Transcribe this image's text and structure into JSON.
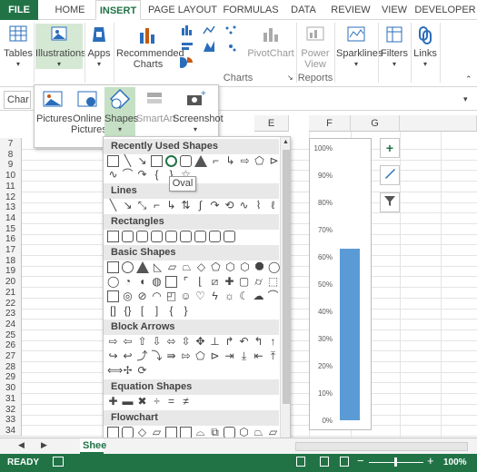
{
  "tabs": [
    "FILE",
    "HOME",
    "INSERT",
    "PAGE LAYOUT",
    "FORMULAS",
    "DATA",
    "REVIEW",
    "VIEW",
    "DEVELOPER"
  ],
  "ribbon": {
    "tables": "Tables",
    "illustrations": "Illustrations",
    "apps": "Apps",
    "recommended_charts": [
      "Recommended",
      "Charts"
    ],
    "pivotchart": "PivotChart",
    "power_view": [
      "Power",
      "View"
    ],
    "sparklines": "Sparklines",
    "filters": "Filters",
    "links": "Links",
    "group_charts": "Charts",
    "group_reports": "Reports"
  },
  "namebox": "Char",
  "illustrations_popup": {
    "pictures": "Pictures",
    "online_pictures": [
      "Online",
      "Pictures"
    ],
    "shapes": "Shapes",
    "smartart": "SmartArt",
    "screenshot": "Screenshot"
  },
  "columns": [
    "F",
    "G",
    "E"
  ],
  "rows": [
    "7",
    "8",
    "9",
    "10",
    "11",
    "12",
    "13",
    "14",
    "15",
    "16",
    "17",
    "18",
    "19",
    "20",
    "21",
    "22",
    "23",
    "24",
    "25",
    "26",
    "27",
    "28",
    "29",
    "30",
    "31",
    "32",
    "33",
    "34"
  ],
  "shapes_menu": {
    "sections": [
      "Recently Used Shapes",
      "Lines",
      "Rectangles",
      "Basic Shapes",
      "Block Arrows",
      "Equation Shapes",
      "Flowchart"
    ],
    "tooltip": "Oval"
  },
  "chart_data": {
    "type": "bar",
    "categories": [
      ""
    ],
    "values": [
      63
    ],
    "ylim": [
      0,
      100
    ],
    "yticks": [
      "100%",
      "90%",
      "80%",
      "70%",
      "60%",
      "50%",
      "40%",
      "30%",
      "20%",
      "10%",
      "0%"
    ],
    "color": "#5b9bd5",
    "grid": false
  },
  "sheet_tab": "Shee",
  "status": {
    "ready": "READY",
    "zoom": "100%"
  },
  "colors": {
    "excel_green": "#217346"
  }
}
